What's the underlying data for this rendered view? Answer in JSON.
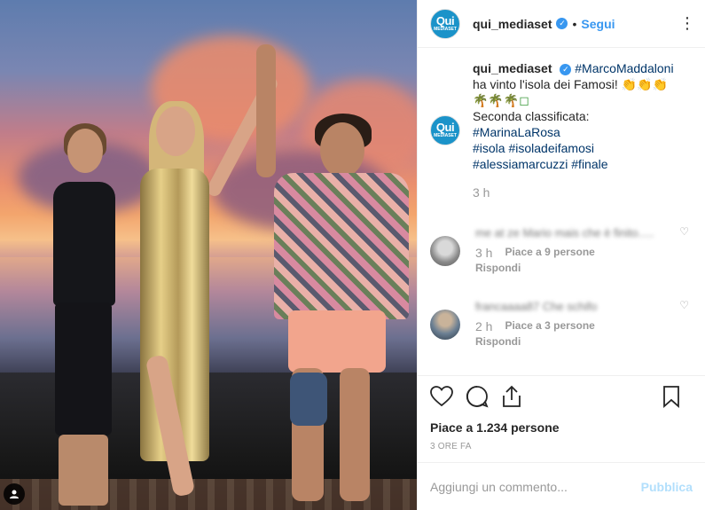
{
  "header": {
    "username": "qui_mediaset",
    "follow_label": "Segui",
    "more_icon": "more-horizontal-icon",
    "avatar_line1": "Qui",
    "avatar_line2": "MEDIASET",
    "separator": "•"
  },
  "caption": {
    "username": "qui_mediaset",
    "mention": "#MarcoMaddaloni",
    "line1_rest": "ha vinto l'isola dei Famosi! 👏👏👏",
    "palms": "🌴🌴🌴◻",
    "line3": "Seconda classificata:",
    "hashtag_second": "#MarinaLaRosa",
    "tags_line1": "#isola #isoladeifamosi",
    "tags_line2": "#alessiamarcuzzi #finale",
    "time": "3 h"
  },
  "comments": [
    {
      "text": "me at ze Mario mais che è finito.....",
      "time": "3 h",
      "likes": "Piace a 9 persone",
      "reply": "Rispondi",
      "avatar_color": "#b9b9b9"
    },
    {
      "text": "francaaaa87 Che schifo",
      "time": "2 h",
      "likes": "Piace a 3 persone",
      "reply": "Rispondi",
      "avatar_color": "#8e9aa6"
    }
  ],
  "actions": {
    "likes": "Piace a 1.234 persone",
    "ago": "3 ORE FA"
  },
  "add_comment": {
    "placeholder": "Aggiungi un commento...",
    "publish": "Pubblica"
  },
  "colors": {
    "accent": "#3897f0",
    "hashtag": "#003569",
    "muted": "#999999",
    "publish_disabled": "#b2dffc"
  }
}
